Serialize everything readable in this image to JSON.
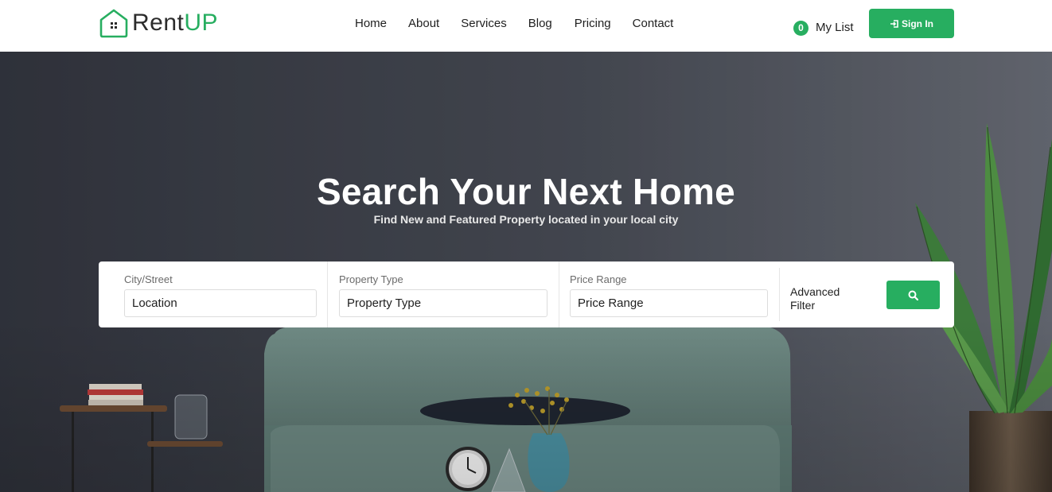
{
  "brand": {
    "part1": "Rent",
    "part2": "UP",
    "accent_color": "#27ae60"
  },
  "nav": [
    {
      "label": "Home"
    },
    {
      "label": "About"
    },
    {
      "label": "Services"
    },
    {
      "label": "Blog"
    },
    {
      "label": "Pricing"
    },
    {
      "label": "Contact"
    }
  ],
  "mylist": {
    "count": "0",
    "label": "My List"
  },
  "signin": {
    "label": "Sign In",
    "icon": "sign-in-icon"
  },
  "hero": {
    "title": "Search Your Next Home",
    "subtitle": "Find New and Featured Property located in your local city"
  },
  "search": {
    "city": {
      "label": "City/Street",
      "placeholder": "Location"
    },
    "type": {
      "label": "Property Type",
      "placeholder": "Property Type"
    },
    "price": {
      "label": "Price Range",
      "placeholder": "Price Range"
    },
    "advanced_label": "Advanced Filter",
    "submit_icon": "search-icon"
  }
}
